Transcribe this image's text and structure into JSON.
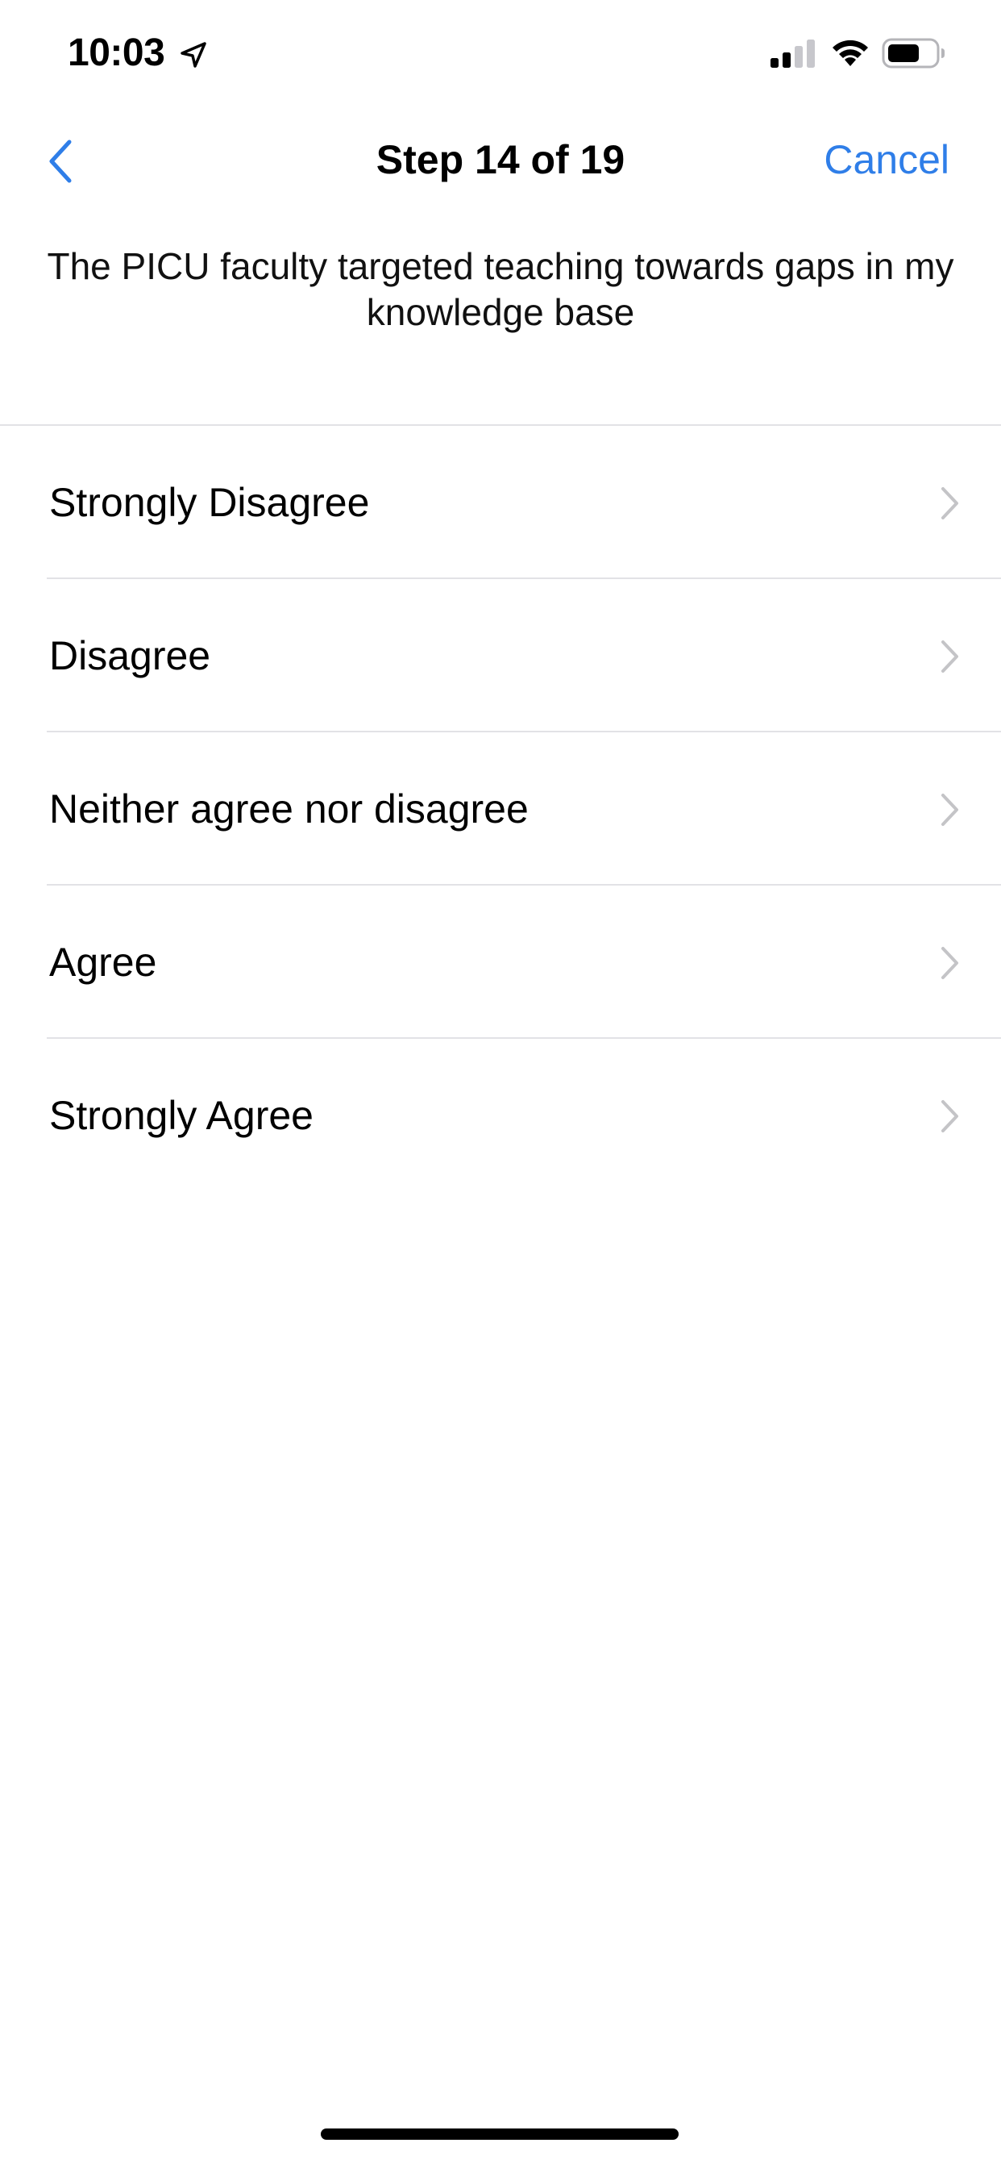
{
  "status_bar": {
    "time": "10:03",
    "icons": [
      "location-arrow-icon",
      "cellular-signal-icon",
      "wifi-icon",
      "battery-icon"
    ]
  },
  "nav": {
    "back_icon": "chevron-left-icon",
    "title": "Step 14 of 19",
    "cancel_label": "Cancel"
  },
  "question": {
    "text": "The PICU faculty targeted teaching towards gaps in my knowledge base"
  },
  "options": [
    {
      "label": "Strongly Disagree"
    },
    {
      "label": "Disagree"
    },
    {
      "label": "Neither agree nor disagree"
    },
    {
      "label": "Agree"
    },
    {
      "label": "Strongly Agree"
    }
  ],
  "colors": {
    "accent": "#2f7ee8",
    "separator": "#e2e2e6",
    "chevron": "#c4c4c7",
    "background": "#ffffff"
  }
}
